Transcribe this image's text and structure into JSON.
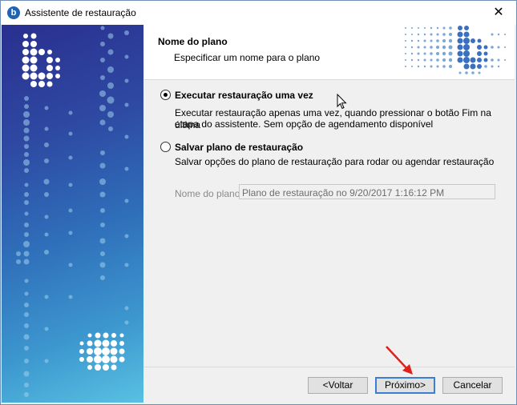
{
  "window": {
    "title": "Assistente de restauração",
    "app_icon": "b",
    "close_glyph": "✕"
  },
  "header": {
    "title": "Nome do plano",
    "subtitle": "Especificar um nome para o plano"
  },
  "options": [
    {
      "label": "Executar restauração uma vez",
      "description_1": "Executar restauração apenas uma vez, quando pressionar o botão Fim na última",
      "description_2": "etapa do assistente. Sem opção de agendamento disponível",
      "checked": true
    },
    {
      "label": "Salvar plano de restauração",
      "description_1": "Salvar opções do plano de restauração para rodar ou agendar restauração",
      "checked": false
    }
  ],
  "plan_name": {
    "label": "Nome do plano:",
    "value": "Plano de restauração no 9/20/2017 1:16:12 PM"
  },
  "buttons": {
    "back": "<Voltar",
    "next": "Próximo>",
    "cancel": "Cancelar"
  },
  "colors": {
    "accent": "#3c7fd1",
    "arrow": "#e0201b",
    "panel_top": "#2a2f8f",
    "panel_bottom": "#58c1e2"
  }
}
